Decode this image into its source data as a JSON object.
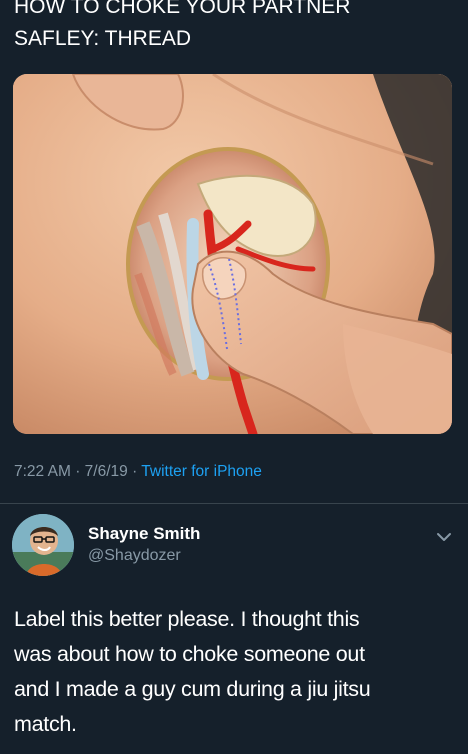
{
  "tweet": {
    "text_lines": [
      "HOW TO CHOKE YOUR PARTNER",
      "SAFLEY: THREAD"
    ],
    "time": "7:22 AM",
    "date": "7/6/19",
    "separator": "·",
    "source": "Twitter for iPhone",
    "media_alt_icon": "neck-anatomy-illustration"
  },
  "reply": {
    "name": "Shayne Smith",
    "handle": "@Shaydozer",
    "text_lines": [
      "Label this better please. I thought this",
      "was about how to choke someone out",
      "and I made a guy cum during a jiu jitsu",
      "match."
    ],
    "more_icon": "chevron-down-icon"
  },
  "colors": {
    "background": "#15202b",
    "text_primary": "#ffffff",
    "text_secondary": "#8899a6",
    "link": "#1da1f2",
    "divider": "#38444d"
  }
}
